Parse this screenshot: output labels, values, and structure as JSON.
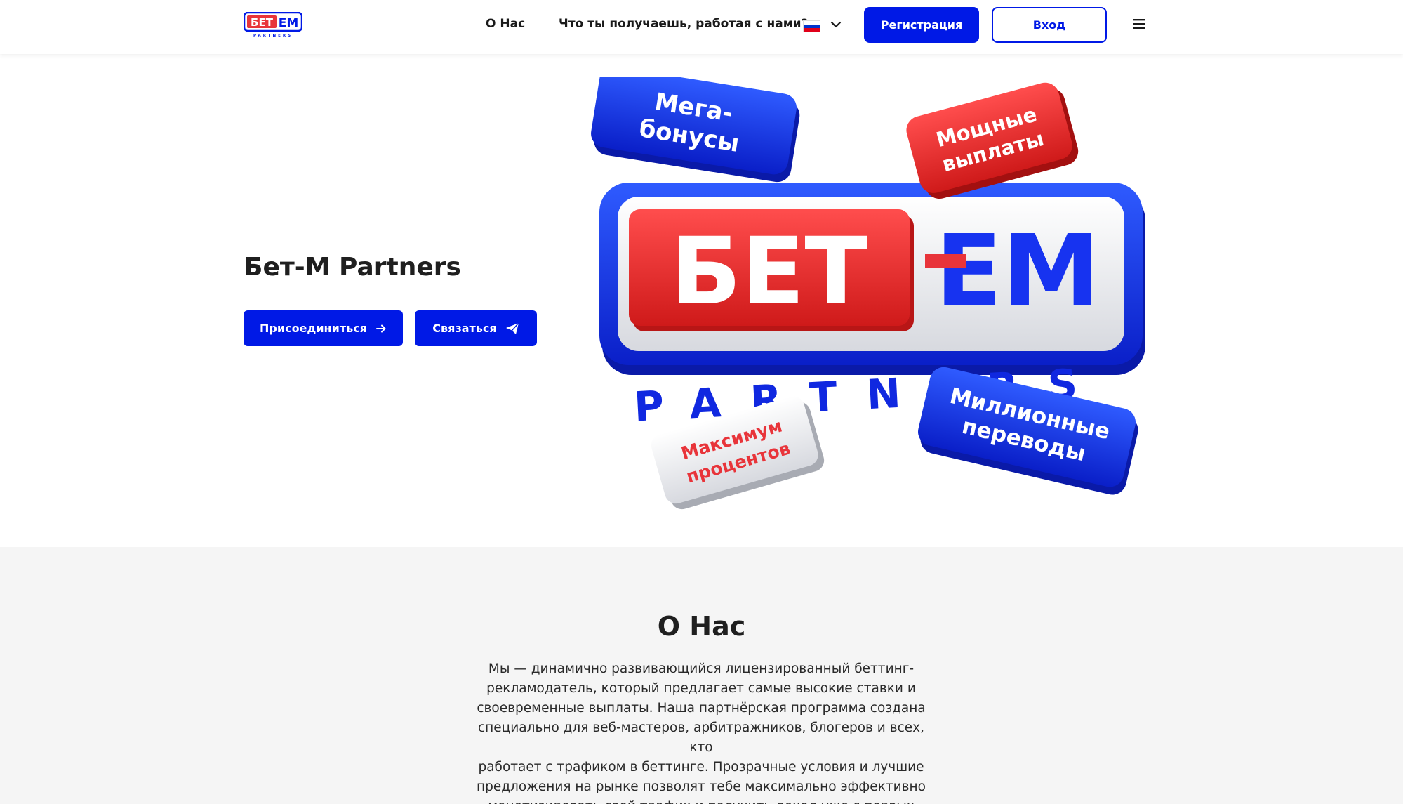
{
  "header": {
    "logo": {
      "main": "БЕТ",
      "accent": "ЕМ",
      "sub": "PARTNERS"
    },
    "nav": {
      "about": "О Нас",
      "benefits": "Что ты получаешь, работая с нами?"
    },
    "language": {
      "selected": "ru",
      "flag_icon": "russia-flag-icon"
    },
    "register_label": "Регистрация",
    "login_label": "Вход",
    "menu_icon": "hamburger-menu-icon"
  },
  "hero": {
    "title": "Бет-М Partners",
    "join_label": "Присоединиться",
    "join_icon": "arrow-right-icon",
    "contact_label": "Связаться",
    "contact_icon": "paper-plane-icon",
    "art": {
      "logo_left": "БЕТ",
      "logo_right": "ЕМ",
      "partners": "PARTNERS",
      "tag_mega": [
        "Мега-",
        "бонусы"
      ],
      "tag_payouts": [
        "Мощные",
        "выплаты"
      ],
      "tag_percent": [
        "Максимум",
        "процентов"
      ],
      "tag_transfers": [
        "Миллионные",
        "переводы"
      ]
    }
  },
  "about": {
    "title": "О Нас",
    "text_lines": [
      "Мы — динамично развивающийся лицензированный беттинг-",
      "рекламодатель, который предлагает самые высокие ставки и",
      "своевременные выплаты. Наша партнёрская программа создана",
      "специально для веб-мастеров, арбитражников, блогеров и всех, кто",
      "работает с трафиком в беттинге. Прозрачные условия и лучшие",
      "предложения на рынке позволят тебе максимально эффективно",
      "монетизировать свой трафик и получить доход уже с первых дней."
    ]
  },
  "colors": {
    "brand_blue": "#0019e6",
    "brand_red": "#e8343a",
    "light_bg": "#f5f5f5"
  }
}
